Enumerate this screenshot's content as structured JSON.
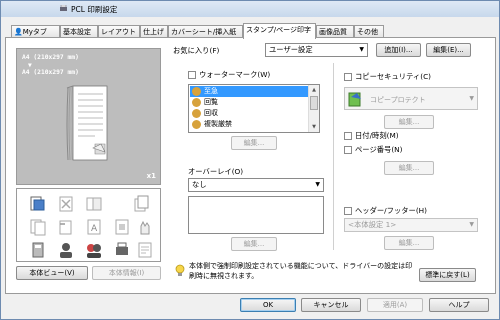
{
  "window": {
    "title": "PCL 印刷設定"
  },
  "tabs": [
    {
      "label": "Myタブ",
      "active": false
    },
    {
      "label": "基本設定",
      "active": false
    },
    {
      "label": "レイアウト",
      "active": false
    },
    {
      "label": "仕上げ",
      "active": false
    },
    {
      "label": "カバーシート/挿入紙",
      "active": false
    },
    {
      "label": "スタンプ/ページ印字",
      "active": true
    },
    {
      "label": "画像品質",
      "active": false
    },
    {
      "label": "その他",
      "active": false
    }
  ],
  "favorites": {
    "label": "お気に入り(F)",
    "value": "ユーザー設定",
    "add_label": "追加(I)...",
    "edit_label": "編集(E)..."
  },
  "preview": {
    "line1": "A4 (210x297 mm)",
    "arrow": "▼",
    "line2": "A4 (210x297 mm)",
    "copies": "x1"
  },
  "left_buttons": {
    "printer_view": "本体ビュー(V)",
    "printer_info": "本体情報(I)"
  },
  "watermark": {
    "label": "ウォーターマーク(W)",
    "checked": false,
    "items": [
      "至急",
      "回覧",
      "回収",
      "複製厳禁"
    ],
    "edit_label": "編集..."
  },
  "overlay": {
    "label": "オーバーレイ(O)",
    "value": "なし",
    "edit_label": "編集..."
  },
  "copy_security": {
    "label": "コピーセキュリティ(C)",
    "checked": false,
    "value": "コピープロテクト",
    "edit_label": "編集..."
  },
  "date_time": {
    "label": "日付/時刻(M)",
    "checked": false
  },
  "page_number": {
    "label": "ページ番号(N)",
    "checked": false,
    "edit_label": "編集..."
  },
  "header_footer": {
    "label": "ヘッダー/フッター(H)",
    "checked": false,
    "value": "<本体設定 1>",
    "edit_label": "編集..."
  },
  "info_message": "本体側で強制印刷設定されている機能について、ドライバーの設定は印刷時に無視されます。",
  "reset_label": "標準に戻す(L)",
  "footer": {
    "ok": "OK",
    "cancel": "キャンセル",
    "apply": "適用(A)",
    "help": "ヘルプ"
  },
  "colors": {
    "selection": "#3399ff",
    "preview_bg": "#bdbdbd",
    "title_bar": "#c7d8ec"
  }
}
